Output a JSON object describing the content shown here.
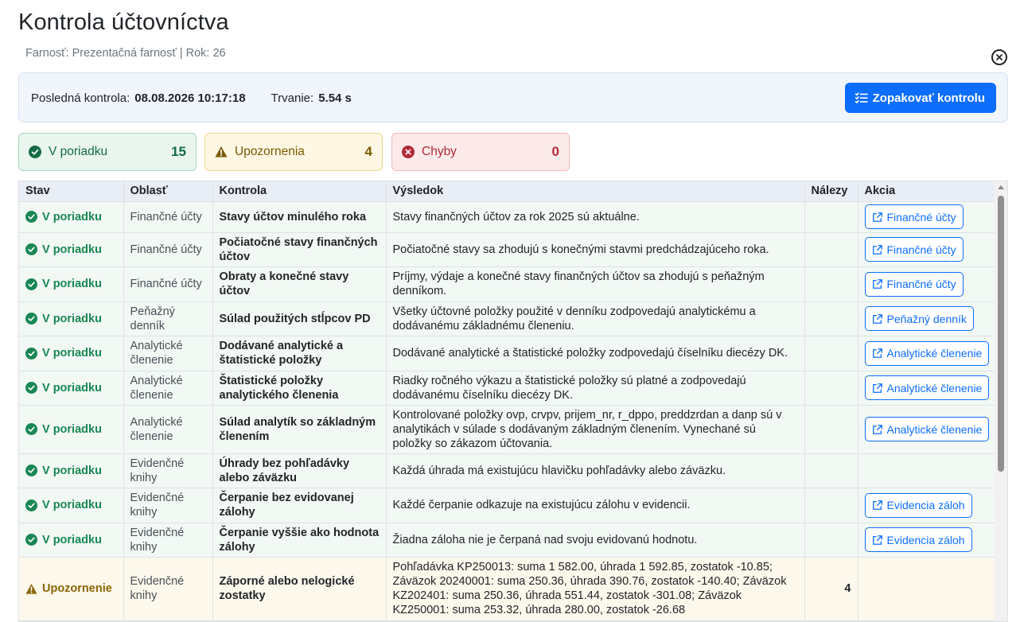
{
  "page": {
    "title": "Kontrola účtovníctva",
    "subtitle": "Farnosť: Prezentačná farnosť | Rok: 26"
  },
  "info": {
    "last_check_label": "Posledná kontrola:",
    "last_check_value": "08.08.2026 10:17:18",
    "duration_label": "Trvanie:",
    "duration_value": "5.54 s",
    "rerun_label": "Zopakovať kontrolu"
  },
  "stats": {
    "ok": {
      "label": "V poriadku",
      "count": "15"
    },
    "warn": {
      "label": "Upozornenia",
      "count": "4"
    },
    "err": {
      "label": "Chyby",
      "count": "0"
    }
  },
  "table": {
    "headers": [
      "Stav",
      "Oblasť",
      "Kontrola",
      "Výsledok",
      "Nálezy",
      "Akcia"
    ],
    "rows": [
      {
        "status": "V poriadku",
        "area": "Finančné účty",
        "check": "Stavy účtov minulého roka",
        "result": "Stavy finančných účtov za rok 2025 sú aktuálne.",
        "findings": "",
        "action": "Finančné účty"
      },
      {
        "status": "V poriadku",
        "area": "Finančné účty",
        "check": "Počiatočné stavy finančných účtov",
        "result": "Počiatočné stavy sa zhodujú s konečnými stavmi predchádzajúceho roka.",
        "findings": "",
        "action": "Finančné účty"
      },
      {
        "status": "V poriadku",
        "area": "Finančné účty",
        "check": "Obraty a konečné stavy účtov",
        "result": "Príjmy, výdaje a konečné stavy finančných účtov sa zhodujú s peňažným denníkom.",
        "findings": "",
        "action": "Finančné účty"
      },
      {
        "status": "V poriadku",
        "area": "Peňažný denník",
        "check": "Súlad použitých stĺpcov PD",
        "result": "Všetky účtovné položky použité v denníku zodpovedajú analytickému a dodávanému základnému členeniu.",
        "findings": "",
        "action": "Peňažný denník"
      },
      {
        "status": "V poriadku",
        "area": "Analytické členenie",
        "check": "Dodávané analytické a štatistické položky",
        "result": "Dodávané analytické a štatistické položky zodpovedajú číselníku diecézy DK.",
        "findings": "",
        "action": "Analytické členenie"
      },
      {
        "status": "V poriadku",
        "area": "Analytické členenie",
        "check": "Štatistické položky analytického členenia",
        "result": "Riadky ročného výkazu a štatistické položky sú platné a zodpovedajú dodávanému číselníku diecézy DK.",
        "findings": "",
        "action": "Analytické členenie"
      },
      {
        "status": "V poriadku",
        "area": "Analytické členenie",
        "check": "Súlad analytík so základným členením",
        "result": "Kontrolované položky ovp, crvpv, prijem_nr, r_dppo, preddzrdan a danp sú v analytikách v súlade s dodávaným základným členením. Vynechané sú položky so zákazom účtovania.",
        "findings": "",
        "action": "Analytické členenie"
      },
      {
        "status": "V poriadku",
        "area": "Evidenčné knihy",
        "check": "Úhrady bez pohľadávky alebo záväzku",
        "result": "Každá úhrada má existujúcu hlavičku pohľadávky alebo záväzku.",
        "findings": "",
        "action": ""
      },
      {
        "status": "V poriadku",
        "area": "Evidenčné knihy",
        "check": "Čerpanie bez evidovanej zálohy",
        "result": "Každé čerpanie odkazuje na existujúcu zálohu v evidencii.",
        "findings": "",
        "action": "Evidencia záloh"
      },
      {
        "status": "V poriadku",
        "area": "Evidenčné knihy",
        "check": "Čerpanie vyššie ako hodnota zálohy",
        "result": "Žiadna záloha nie je čerpaná nad svoju evidovanú hodnotu.",
        "findings": "",
        "action": "Evidencia záloh"
      },
      {
        "status": "Upozornenie",
        "area": "Evidenčné knihy",
        "check": "Záporné alebo nelogické zostatky",
        "result": "Pohľadávka KP250013: suma 1 582.00, úhrada 1 592.85, zostatok -10.85; Záväzok 20240001: suma 250.36, úhrada 390.76, zostatok -140.40; Záväzok KZ202401: suma 250.36, úhrada 551.44, zostatok -301.08; Záväzok KZ250001: suma 253.32, úhrada 280.00, zostatok -26.68",
        "findings": "4",
        "action": ""
      }
    ]
  },
  "colors": {
    "ok": "#198754",
    "warn": "#8a6500",
    "err": "#b02a37",
    "primary": "#0d6efd"
  }
}
